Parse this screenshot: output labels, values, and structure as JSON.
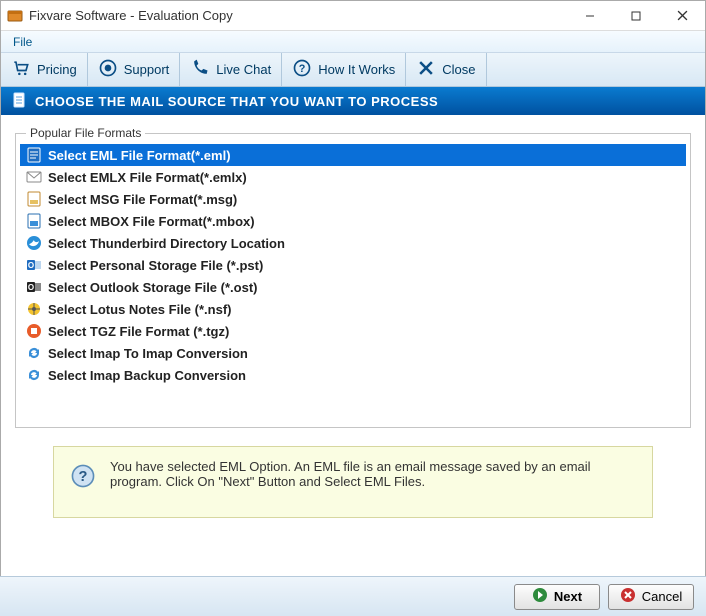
{
  "window": {
    "title": "Fixvare Software - Evaluation Copy"
  },
  "menubar": {
    "file": "File"
  },
  "toolbar": {
    "pricing": "Pricing",
    "support": "Support",
    "livechat": "Live Chat",
    "howitworks": "How It Works",
    "close": "Close"
  },
  "section": {
    "header_text": "CHOOSE THE MAIL SOURCE THAT YOU WANT TO PROCESS"
  },
  "group": {
    "label": "Popular File Formats"
  },
  "formats": [
    {
      "label": "Select EML File Format(*.eml)",
      "icon": "file-eml",
      "selected": true
    },
    {
      "label": "Select EMLX File Format(*.emlx)",
      "icon": "mail",
      "selected": false
    },
    {
      "label": "Select MSG File Format(*.msg)",
      "icon": "file-msg",
      "selected": false
    },
    {
      "label": "Select MBOX File Format(*.mbox)",
      "icon": "file-mbox",
      "selected": false
    },
    {
      "label": "Select Thunderbird Directory Location",
      "icon": "thunderbird",
      "selected": false
    },
    {
      "label": "Select Personal Storage File (*.pst)",
      "icon": "outlook",
      "selected": false
    },
    {
      "label": "Select Outlook Storage File (*.ost)",
      "icon": "outlook-dark",
      "selected": false
    },
    {
      "label": "Select Lotus Notes File (*.nsf)",
      "icon": "lotus",
      "selected": false
    },
    {
      "label": "Select TGZ File Format (*.tgz)",
      "icon": "archive",
      "selected": false
    },
    {
      "label": "Select Imap To Imap Conversion",
      "icon": "sync",
      "selected": false
    },
    {
      "label": "Select Imap Backup Conversion",
      "icon": "sync",
      "selected": false
    }
  ],
  "info": {
    "text": "You have selected EML Option. An EML file is an email message saved by an email program. Click On \"Next\" Button and Select EML Files."
  },
  "footer": {
    "next": "Next",
    "cancel": "Cancel"
  }
}
